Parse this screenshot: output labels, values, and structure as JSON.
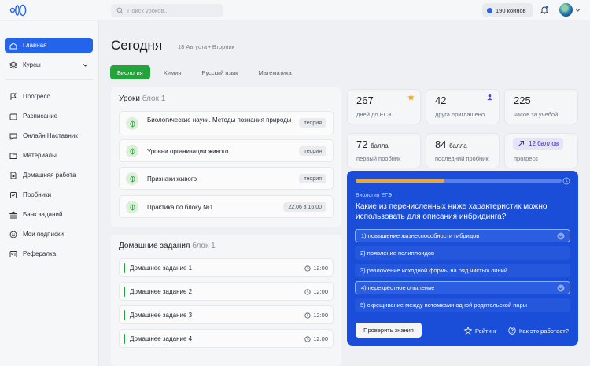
{
  "header": {
    "search_placeholder": "Поиск уроков...",
    "coins": "190 коинов"
  },
  "sidebar": {
    "items": [
      {
        "label": "Главная",
        "icon": "home-icon"
      },
      {
        "label": "Курсы",
        "icon": "layers-icon"
      },
      {
        "label": "Прогресс",
        "icon": "flag-icon"
      },
      {
        "label": "Расписание",
        "icon": "calendar-icon"
      },
      {
        "label": "Онлайн Наставник",
        "icon": "chat-icon"
      },
      {
        "label": "Материалы",
        "icon": "folder-icon"
      },
      {
        "label": "Домашняя работа",
        "icon": "document-icon"
      },
      {
        "label": "Пробники",
        "icon": "checkbox-icon"
      },
      {
        "label": "Банк заданий",
        "icon": "bank-icon"
      },
      {
        "label": "Мои подписки",
        "icon": "smile-icon"
      },
      {
        "label": "Рефералка",
        "icon": "referral-icon"
      }
    ]
  },
  "main": {
    "title": "Сегодня",
    "date": "18 Августа • Вторник",
    "tabs": [
      "Биология",
      "Химия",
      "Русский язык",
      "Математика"
    ]
  },
  "lessons": {
    "title": "Уроки",
    "subtitle": "блок 1",
    "items": [
      {
        "name": "Биологические науки. Методы познания природы",
        "tag": "теория"
      },
      {
        "name": "Уровни организации живого",
        "tag": "теория"
      },
      {
        "name": "Признаки живого",
        "tag": "теория"
      },
      {
        "name": "Практика по блоку №1",
        "tag": "22.06 в 16:00"
      }
    ]
  },
  "homework": {
    "title": "Домашние задания",
    "subtitle": "блок 1",
    "items": [
      {
        "name": "Домашнее задание 1",
        "time": "12:00"
      },
      {
        "name": "Домашнее задание 2",
        "time": "12:00"
      },
      {
        "name": "Домашнее задание 3",
        "time": "12:00"
      },
      {
        "name": "Домашнее задание 4",
        "time": "12:00"
      }
    ]
  },
  "stats": [
    {
      "value": "267",
      "label": "дней до ЕГЭ"
    },
    {
      "value": "42",
      "label": "друга приглашено"
    },
    {
      "value": "225",
      "label": "часов за учебой"
    },
    {
      "value": "72",
      "unit": "балла",
      "label": "первый пробник"
    },
    {
      "value": "84",
      "unit": "балла",
      "label": "последний пробник"
    },
    {
      "value": "12 баллов",
      "label": "прогресс"
    }
  ],
  "quiz": {
    "progress": 0.43,
    "subject": "Биология ЕГЭ",
    "question": "Какие из перечисленных ниже характеристик можно использовать для описания инбридинга?",
    "options": [
      {
        "text": "1)  повышение жизнеспособности гибридов",
        "selected": true
      },
      {
        "text": "2)  появление полиплоидов",
        "selected": false
      },
      {
        "text": "3)  разложение исходной формы на ряд чистых линий",
        "selected": false
      },
      {
        "text": "4)  перекрёстное опыление",
        "selected": true
      },
      {
        "text": "5)  скрещивание между потомками одной родительской пары",
        "selected": false
      }
    ],
    "check_button": "Проверить знания",
    "rating_link": "Рейтинг",
    "how_link": "Как это работает?"
  },
  "colors": {
    "accent": "#2463eb",
    "green": "#22a43a",
    "quiz_bg": "#1b4ed8",
    "progress": "#f1a52a"
  }
}
